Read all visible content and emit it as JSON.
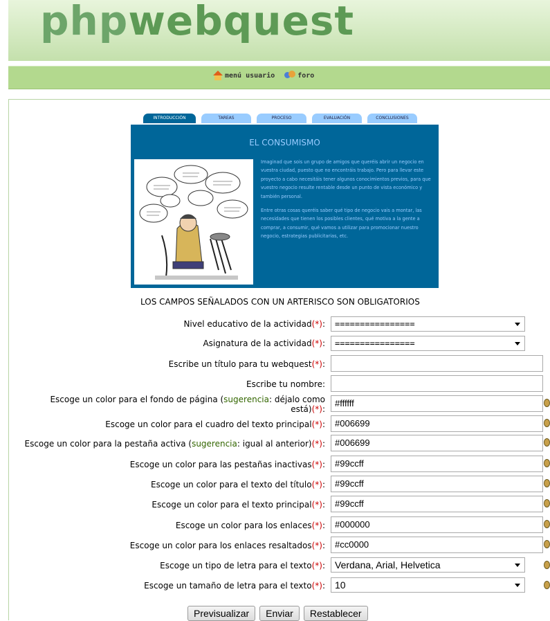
{
  "header": {
    "logo_part1": "php",
    "logo_part2": "webquest"
  },
  "nav": {
    "menu_label": "menú usuario",
    "forum_label": "foro"
  },
  "preview": {
    "tabs": [
      "INTRODUCCIÓN",
      "TAREAS",
      "PROCESO",
      "EVALUACIÓN",
      "CONCLUSIONES"
    ],
    "title": "EL CONSUMISMO",
    "paragraph1": "Imaginad que sois un grupo de amigos que queréis abrir un negocio en vuestra ciudad, puesto que no encontráis trabajo. Pero para llevar este proyecto a cabo necesitáis tener algunos conocimientos previos, para que vuestro negocio resulte rentable desde un punto de vista económico y también personal.",
    "paragraph2": "Entre otras cosas queréis saber qué tipo de negocio vais a montar, las necesidades que tienen los posibles clientes, qué motiva a la gente a comprar, a consumir, qué vamos a utilizar para promocionar nuestro negocio, estrategias publicitarias, etc."
  },
  "form": {
    "required_note": "LOS CAMPOS SEÑALADOS CON UN ARTERISCO SON OBLIGATORIOS",
    "asterisk": "(*)",
    "colon": ":",
    "suggestion_word": "sugerencia",
    "nivel_label": "Nivel educativo de la actividad",
    "nivel_value": "================",
    "asignatura_label": "Asignatura de la actividad",
    "asignatura_value": "================",
    "titulo_label": "Escribe un título para tu webquest",
    "titulo_value": "",
    "nombre_label": "Escribe tu nombre:",
    "nombre_value": "",
    "fondo_label_a": "Escoge un color para el fondo de página (",
    "fondo_label_b": ": déjalo como",
    "fondo_label_c": "está)",
    "fondo_value": "#ffffff",
    "cuadro_label": "Escoge un color para el cuadro del texto principal",
    "cuadro_value": "#006699",
    "activa_label_a": "Escoge un color para la pestaña activa (",
    "activa_label_b": ": igual al anterior)",
    "activa_value": "#006699",
    "inactivas_label": "Escoge un color para las pestañas inactivas",
    "inactivas_value": "#99ccff",
    "titulo_color_label": "Escoge un color para el texto del título",
    "titulo_color_value": "#99ccff",
    "principal_label": "Escoge un color para el texto principal",
    "principal_value": "#99ccff",
    "enlaces_label": "Escoge un color para los enlaces",
    "enlaces_value": "#000000",
    "resaltados_label": "Escoge un color para los enlaces resaltados",
    "resaltados_value": "#cc0000",
    "fuente_label": "Escoge un tipo de letra para el texto",
    "fuente_value": "Verdana, Arial, Helvetica",
    "tamano_label": "Escoge un tamaño de letra para el texto",
    "tamano_value": "10",
    "btn_preview": "Previsualizar",
    "btn_send": "Enviar",
    "btn_reset": "Restablecer"
  },
  "colors": {
    "header_green": "#c4e0ac",
    "nav_green": "#b3d98e",
    "box_blue": "#006699",
    "tab_light": "#99ccff",
    "required_red": "#cc0000",
    "suggestion_green": "#336600"
  },
  "icons": [
    "home-icon",
    "forum-icon",
    "palette-icon",
    "chevron-down-icon"
  ]
}
